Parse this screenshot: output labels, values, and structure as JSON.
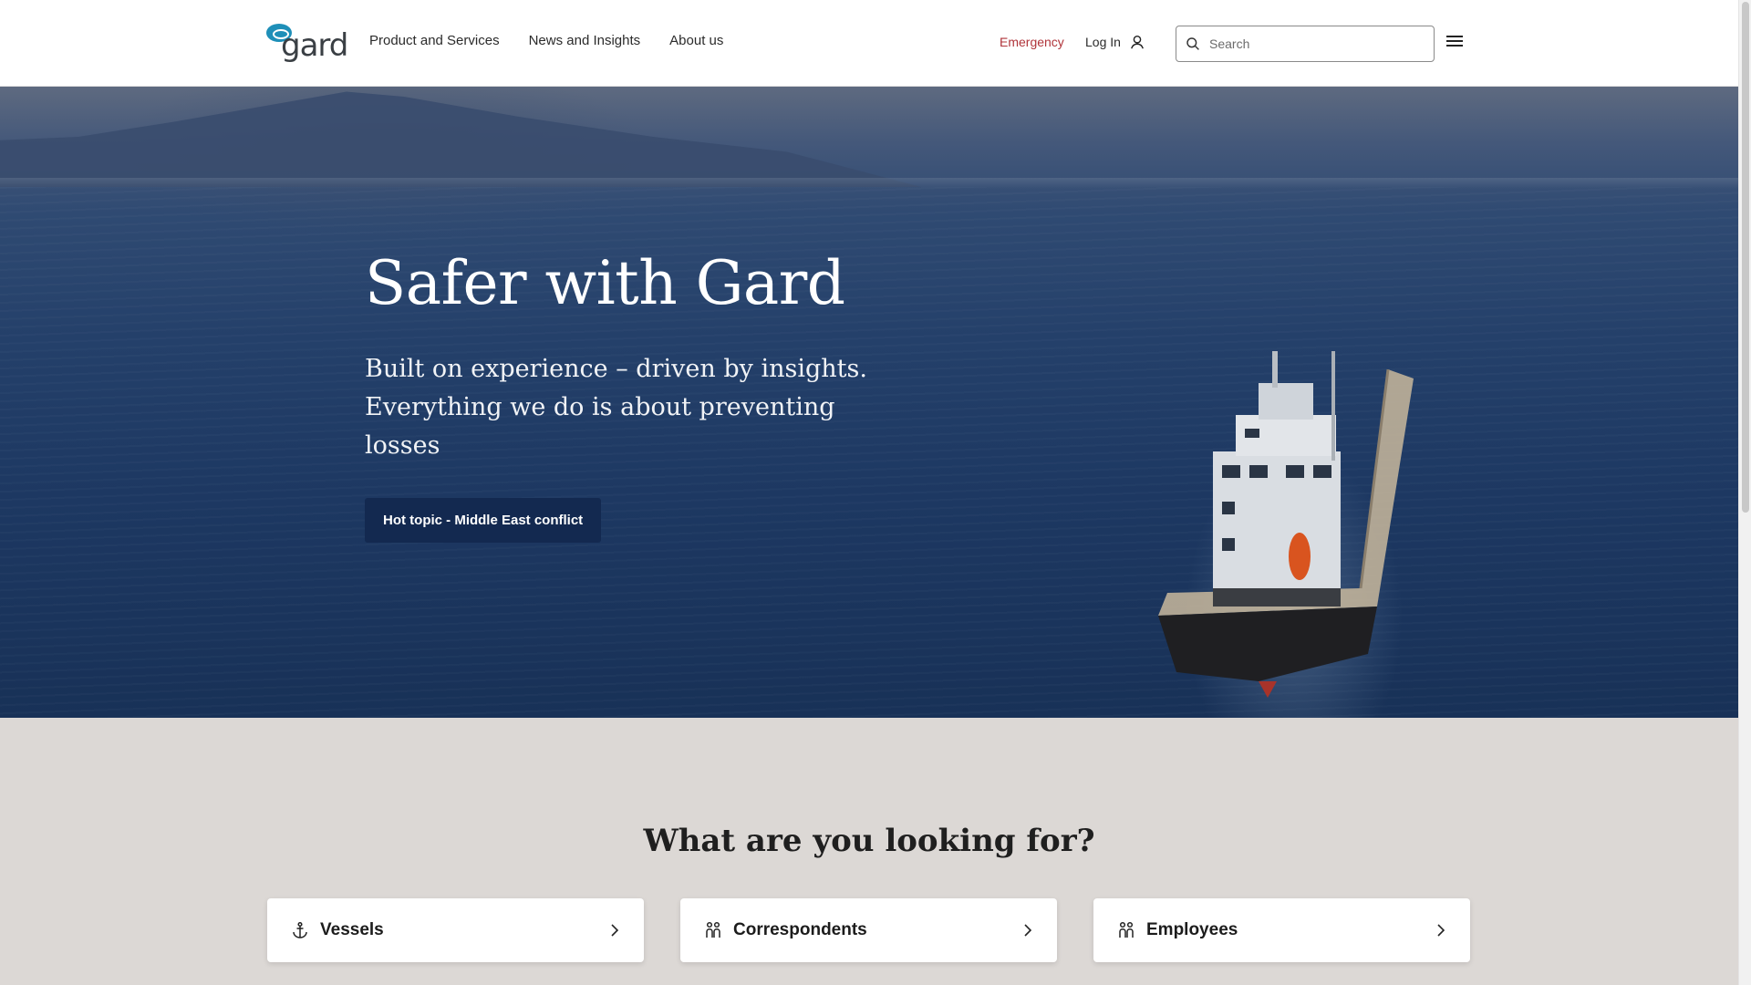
{
  "brand": {
    "logo_text": "gard"
  },
  "nav": {
    "items": [
      {
        "label": "Product and Services"
      },
      {
        "label": "News and Insights"
      },
      {
        "label": "About us"
      }
    ]
  },
  "utility": {
    "emergency_label": "Emergency",
    "login_label": "Log In"
  },
  "search": {
    "placeholder": "Search",
    "value": ""
  },
  "hero": {
    "title": "Safer with Gard",
    "subtitle": "Built on experience – driven by insights. Everything we do is about preventing losses",
    "cta_label": "Hot topic - Middle East conflict"
  },
  "lookup": {
    "title": "What are you looking for?",
    "cards": [
      {
        "label": "Vessels",
        "icon": "anchor-icon"
      },
      {
        "label": "Correspondents",
        "icon": "people-icon"
      },
      {
        "label": "Employees",
        "icon": "people-icon"
      }
    ]
  },
  "colors": {
    "emergency": "#b0343a",
    "cta_background": "#132950",
    "lower_background": "#dcd8d5",
    "logo_mark": "#1e8fb8"
  }
}
